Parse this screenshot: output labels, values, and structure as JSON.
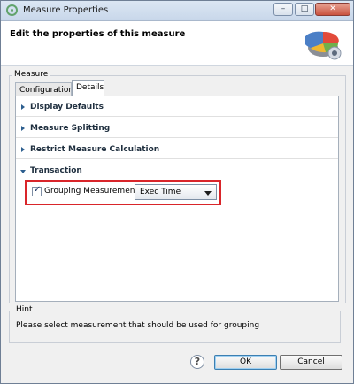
{
  "window": {
    "title": "Measure Properties",
    "controls": {
      "minimize": "–",
      "maximize": "□",
      "close": "✕"
    }
  },
  "header": {
    "title": "Edit the properties of this measure",
    "icon": "pie-chart-icon"
  },
  "measure_group": {
    "legend": "Measure",
    "tabs": [
      {
        "label": "Configuration",
        "active": false
      },
      {
        "label": "Details",
        "active": true
      }
    ],
    "sections": [
      {
        "label": "Display Defaults",
        "expanded": false
      },
      {
        "label": "Measure Splitting",
        "expanded": false
      },
      {
        "label": "Restrict Measure Calculation",
        "expanded": false
      },
      {
        "label": "Transaction",
        "expanded": true
      }
    ],
    "transaction": {
      "grouping_checkbox": {
        "label": "Grouping Measurement:",
        "checked": true
      },
      "grouping_select": {
        "value": "Exec Time"
      }
    }
  },
  "hint": {
    "title": "Hint",
    "text": "Please select measurement that should be used for grouping"
  },
  "buttons": {
    "help": "?",
    "ok": "OK",
    "cancel": "Cancel"
  },
  "colors": {
    "highlight": "#d9252a",
    "accent": "#2d5f8f"
  }
}
